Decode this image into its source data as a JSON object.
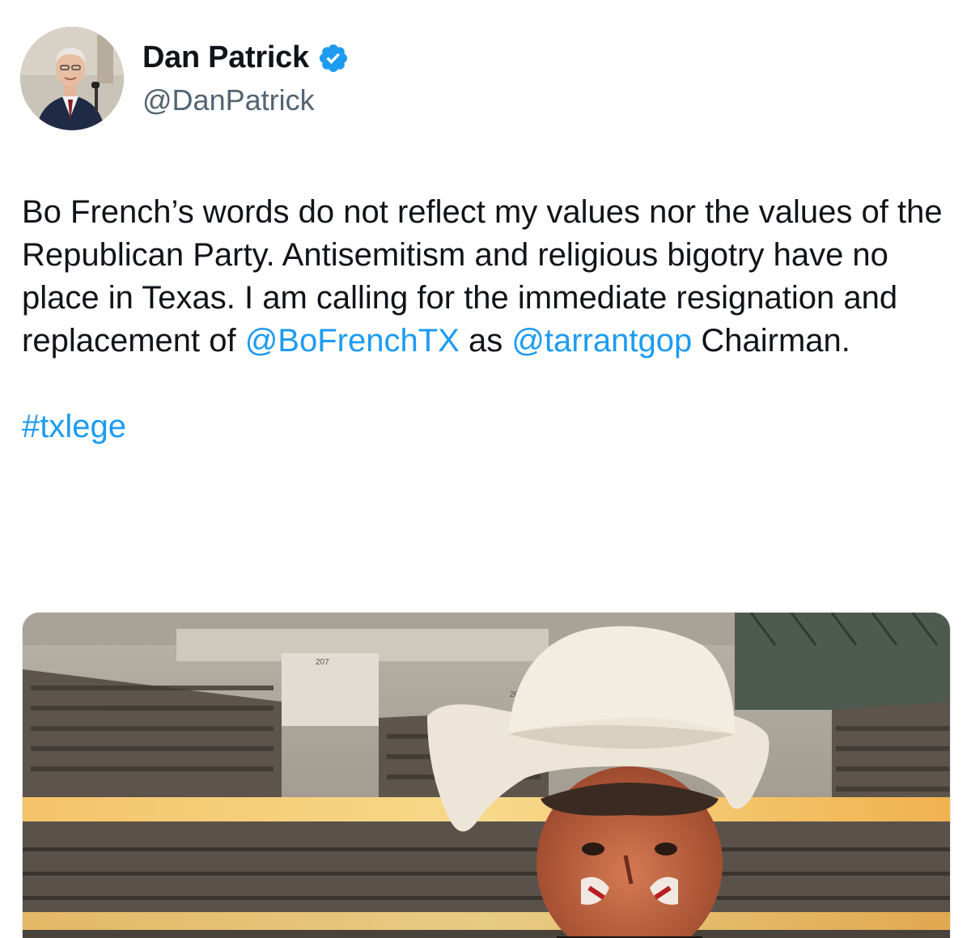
{
  "author": {
    "display_name": "Dan Patrick",
    "handle": "@DanPatrick",
    "verified_icon": "verified-badge-icon",
    "avatar": "profile-photo"
  },
  "tweet": {
    "line_parts": {
      "intro": "Bo French’s words do not reflect my values nor the values of the Republican Party. Antisemitism and religious bigotry have no place in Texas. I am calling for the immediate resignation and replacement of ",
      "mention_1": "@BoFrenchTX",
      "between": " as ",
      "mention_2": "@tarrantgop",
      "outro": " Chairman."
    },
    "hashtag": "#txlege"
  },
  "media": {
    "description_icon": "stadium-photo",
    "section_labels": [
      "207",
      "208"
    ]
  },
  "colors": {
    "link": "#1d9bf0",
    "text": "#0f1419",
    "secondary": "#536471",
    "verified": "#1d9bf0"
  }
}
